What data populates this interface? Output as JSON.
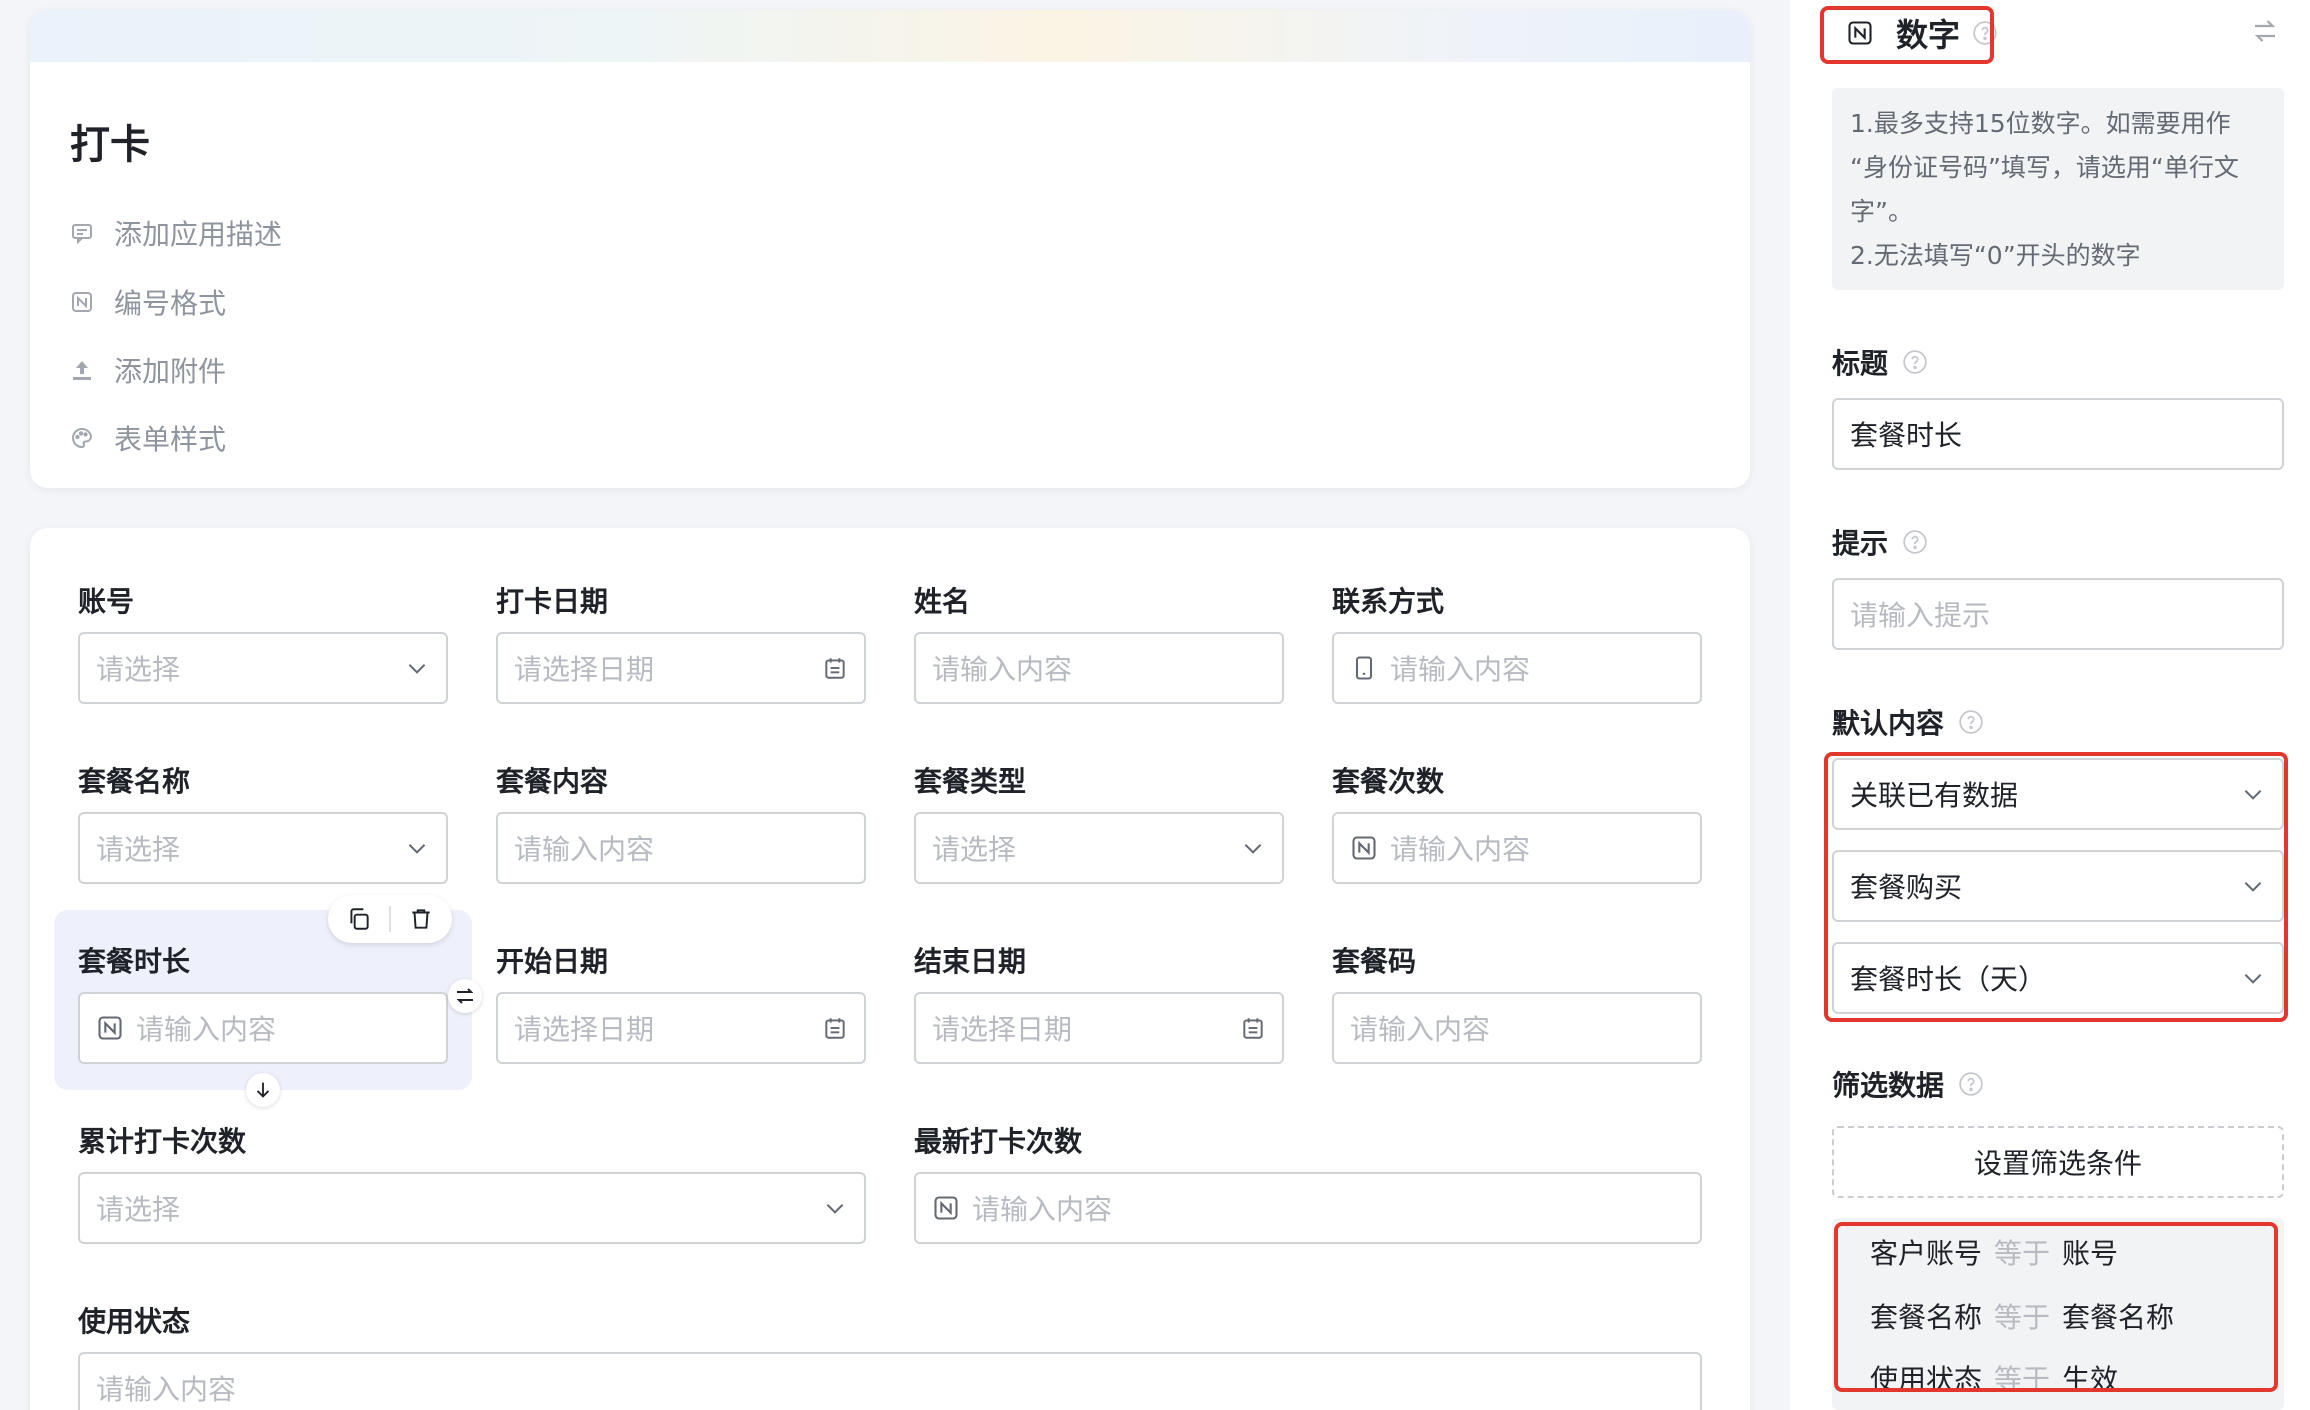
{
  "app": {
    "title": "打卡",
    "meta_items": [
      {
        "icon": "comment-icon",
        "label": "添加应用描述"
      },
      {
        "icon": "number-format-icon",
        "label": "编号格式"
      },
      {
        "icon": "upload-icon",
        "label": "添加附件"
      },
      {
        "icon": "palette-icon",
        "label": "表单样式"
      }
    ]
  },
  "form": {
    "fields": [
      {
        "label": "账号",
        "placeholder": "请选择",
        "type": "select"
      },
      {
        "label": "打卡日期",
        "placeholder": "请选择日期",
        "type": "date"
      },
      {
        "label": "姓名",
        "placeholder": "请输入内容",
        "type": "text"
      },
      {
        "label": "联系方式",
        "placeholder": "请输入内容",
        "type": "phone"
      },
      {
        "label": "套餐名称",
        "placeholder": "请选择",
        "type": "select"
      },
      {
        "label": "套餐内容",
        "placeholder": "请输入内容",
        "type": "text"
      },
      {
        "label": "套餐类型",
        "placeholder": "请选择",
        "type": "select"
      },
      {
        "label": "套餐次数",
        "placeholder": "请输入内容",
        "type": "number"
      },
      {
        "label": "套餐时长",
        "placeholder": "请输入内容",
        "type": "number",
        "selected": true
      },
      {
        "label": "开始日期",
        "placeholder": "请选择日期",
        "type": "date"
      },
      {
        "label": "结束日期",
        "placeholder": "请选择日期",
        "type": "date"
      },
      {
        "label": "套餐码",
        "placeholder": "请输入内容",
        "type": "text"
      },
      {
        "label": "累计打卡次数",
        "placeholder": "请选择",
        "type": "select"
      },
      {
        "label": "最新打卡次数",
        "placeholder": "请输入内容",
        "type": "number"
      },
      {
        "label": "使用状态",
        "placeholder": "请输入内容",
        "type": "text"
      }
    ]
  },
  "panel": {
    "type_label": "数字",
    "description": [
      "1.最多支持15位数字。如需要用作",
      "“身份证号码”填写，请选用“单行文",
      "字”。",
      "2.无法填写“0”开头的数字"
    ],
    "title_label": "标题",
    "title_value": "套餐时长",
    "hint_label": "提示",
    "hint_placeholder": "请输入提示",
    "default_label": "默认内容",
    "default_mode": "关联已有数据",
    "linked_form": "套餐购买",
    "linked_field": "套餐时长（天）",
    "filter_label": "筛选数据",
    "filter_button": "设置筛选条件",
    "conditions": [
      {
        "left": "客户账号",
        "op": "等于",
        "right": "账号"
      },
      {
        "left": "套餐名称",
        "op": "等于",
        "right": "套餐名称"
      },
      {
        "left": "使用状态",
        "op": "等于",
        "right": "生效"
      }
    ]
  },
  "colors": {
    "highlight_red": "#e3362c",
    "selected_bg": "#eef0fb"
  }
}
